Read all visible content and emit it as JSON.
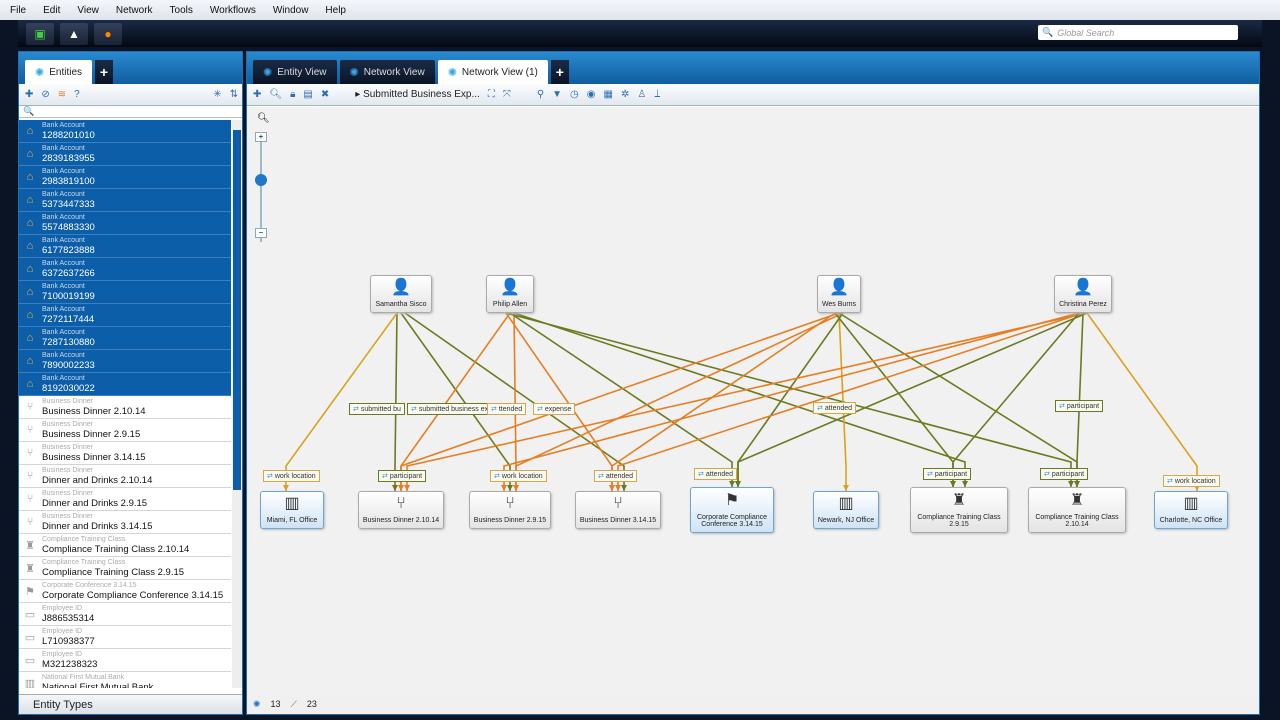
{
  "menu": [
    "File",
    "Edit",
    "View",
    "Network",
    "Tools",
    "Workflows",
    "Window",
    "Help"
  ],
  "toolbar": {
    "icons": [
      "import-icon",
      "upload-icon",
      "globe-icon"
    ],
    "global_search_placeholder": "Global Search"
  },
  "left": {
    "tab": "Entities",
    "search_value": "",
    "entity_types_label": "Entity Types",
    "items": [
      {
        "type": "Bank Account",
        "name": "1288201010",
        "sel": true,
        "icon": "bank-icon"
      },
      {
        "type": "Bank Account",
        "name": "2839183955",
        "sel": true,
        "icon": "bank-icon"
      },
      {
        "type": "Bank Account",
        "name": "2983819100",
        "sel": true,
        "icon": "bank-icon"
      },
      {
        "type": "Bank Account",
        "name": "5373447333",
        "sel": true,
        "icon": "bank-icon"
      },
      {
        "type": "Bank Account",
        "name": "5574883330",
        "sel": true,
        "icon": "bank-icon"
      },
      {
        "type": "Bank Account",
        "name": "6177823888",
        "sel": true,
        "icon": "bank-icon"
      },
      {
        "type": "Bank Account",
        "name": "6372637266",
        "sel": true,
        "icon": "bank-icon"
      },
      {
        "type": "Bank Account",
        "name": "7100019199",
        "sel": true,
        "icon": "bank-icon"
      },
      {
        "type": "Bank Account",
        "name": "7272117444",
        "sel": true,
        "icon": "bank-icon"
      },
      {
        "type": "Bank Account",
        "name": "7287130880",
        "sel": true,
        "icon": "bank-icon"
      },
      {
        "type": "Bank Account",
        "name": "7890002233",
        "sel": true,
        "icon": "bank-icon"
      },
      {
        "type": "Bank Account",
        "name": "8192030022",
        "sel": true,
        "icon": "bank-icon"
      },
      {
        "type": "Business Dinner",
        "name": "Business Dinner 2.10.14",
        "sel": false,
        "icon": "dinner-icon"
      },
      {
        "type": "Business Dinner",
        "name": "Business Dinner 2.9.15",
        "sel": false,
        "icon": "dinner-icon"
      },
      {
        "type": "Business Dinner",
        "name": "Business Dinner 3.14.15",
        "sel": false,
        "icon": "dinner-icon"
      },
      {
        "type": "Business Dinner",
        "name": "Dinner and Drinks 2.10.14",
        "sel": false,
        "icon": "dinner-icon"
      },
      {
        "type": "Business Dinner",
        "name": "Dinner and Drinks 2.9.15",
        "sel": false,
        "icon": "dinner-icon"
      },
      {
        "type": "Business Dinner",
        "name": "Dinner and Drinks 3.14.15",
        "sel": false,
        "icon": "dinner-icon"
      },
      {
        "type": "Compliance Training Class",
        "name": "Compliance Training Class 2.10.14",
        "sel": false,
        "icon": "training-icon"
      },
      {
        "type": "Compliance Training Class",
        "name": "Compliance Training Class 2.9.15",
        "sel": false,
        "icon": "training-icon"
      },
      {
        "type": "Corporate Conference 3.14.15",
        "name": "Corporate Compliance Conference 3.14.15",
        "sel": false,
        "icon": "conference-icon"
      },
      {
        "type": "Employee ID",
        "name": "J886535314",
        "sel": false,
        "icon": "id-card-icon"
      },
      {
        "type": "Employee ID",
        "name": "L710938377",
        "sel": false,
        "icon": "id-card-icon"
      },
      {
        "type": "Employee ID",
        "name": "M321238323",
        "sel": false,
        "icon": "id-card-icon"
      },
      {
        "type": "National First Mutual Bank",
        "name": "National First Mutual Bank",
        "sel": false,
        "icon": "bank-building-icon"
      }
    ]
  },
  "right": {
    "tabs": [
      {
        "label": "Entity View",
        "active": false
      },
      {
        "label": "Network View",
        "active": false
      },
      {
        "label": "Network View (1)",
        "active": true
      }
    ],
    "breadcrumb": "Submitted Business Exp...",
    "status": {
      "entities": "13",
      "links": "23"
    }
  },
  "colors": {
    "accent": "#0d5ea8",
    "work_location": "#d9a21c",
    "attended": "#e67e22",
    "participant": "#6b7a1f"
  },
  "graph": {
    "nodes": [
      {
        "id": "ss",
        "label": "Samantha Sisco",
        "kind": "person"
      },
      {
        "id": "pa",
        "label": "Philip Allen",
        "kind": "person"
      },
      {
        "id": "wb",
        "label": "Wes Burns",
        "kind": "person"
      },
      {
        "id": "cp",
        "label": "Christina Perez",
        "kind": "person"
      },
      {
        "id": "mi",
        "label": "Miami, FL Office",
        "kind": "office"
      },
      {
        "id": "bd1",
        "label": "Business Dinner 2.10.14",
        "kind": "dinner"
      },
      {
        "id": "bd2",
        "label": "Business Dinner 2.9.15",
        "kind": "dinner"
      },
      {
        "id": "bd3",
        "label": "Business Dinner 3.14.15",
        "kind": "dinner"
      },
      {
        "id": "cc",
        "label": "Corporate Compliance Conference 3.14.15",
        "kind": "conference"
      },
      {
        "id": "nw",
        "label": "Newark, NJ Office",
        "kind": "office"
      },
      {
        "id": "ct1",
        "label": "Compliance Training Class 2.9.15",
        "kind": "training"
      },
      {
        "id": "ct2",
        "label": "Compliance Training Class 2.10.14",
        "kind": "training"
      },
      {
        "id": "ch",
        "label": "Charlotte, NC Office",
        "kind": "office"
      }
    ],
    "edges": [
      {
        "from": "ss",
        "to": "bd1",
        "type": "participant"
      },
      {
        "from": "ss",
        "to": "bd2",
        "type": "participant"
      },
      {
        "from": "ss",
        "to": "bd3",
        "type": "participant"
      },
      {
        "from": "ss",
        "to": "mi",
        "type": "work_location"
      },
      {
        "from": "pa",
        "to": "bd1",
        "type": "attended"
      },
      {
        "from": "pa",
        "to": "bd2",
        "type": "attended"
      },
      {
        "from": "pa",
        "to": "bd3",
        "type": "attended"
      },
      {
        "from": "pa",
        "to": "cc",
        "type": "participant"
      },
      {
        "from": "pa",
        "to": "ct1",
        "type": "participant"
      },
      {
        "from": "pa",
        "to": "ct2",
        "type": "participant"
      },
      {
        "from": "wb",
        "to": "bd1",
        "type": "attended"
      },
      {
        "from": "wb",
        "to": "bd2",
        "type": "attended"
      },
      {
        "from": "wb",
        "to": "bd3",
        "type": "attended"
      },
      {
        "from": "wb",
        "to": "nw",
        "type": "work_location"
      },
      {
        "from": "wb",
        "to": "cc",
        "type": "participant"
      },
      {
        "from": "wb",
        "to": "ct1",
        "type": "participant"
      },
      {
        "from": "wb",
        "to": "ct2",
        "type": "participant"
      },
      {
        "from": "cp",
        "to": "bd1",
        "type": "attended"
      },
      {
        "from": "cp",
        "to": "bd2",
        "type": "attended"
      },
      {
        "from": "cp",
        "to": "bd3",
        "type": "attended"
      },
      {
        "from": "cp",
        "to": "cc",
        "type": "participant"
      },
      {
        "from": "cp",
        "to": "ct1",
        "type": "participant"
      },
      {
        "from": "cp",
        "to": "ct2",
        "type": "participant"
      },
      {
        "from": "cp",
        "to": "ch",
        "type": "work_location"
      }
    ],
    "edge_labels": [
      "submitted bu",
      "submitted business expense",
      "ttended",
      "expense",
      "work location",
      "participant",
      "work location",
      "attended",
      "attended",
      "attended",
      "participant",
      "participant",
      "participant",
      "work location"
    ]
  }
}
